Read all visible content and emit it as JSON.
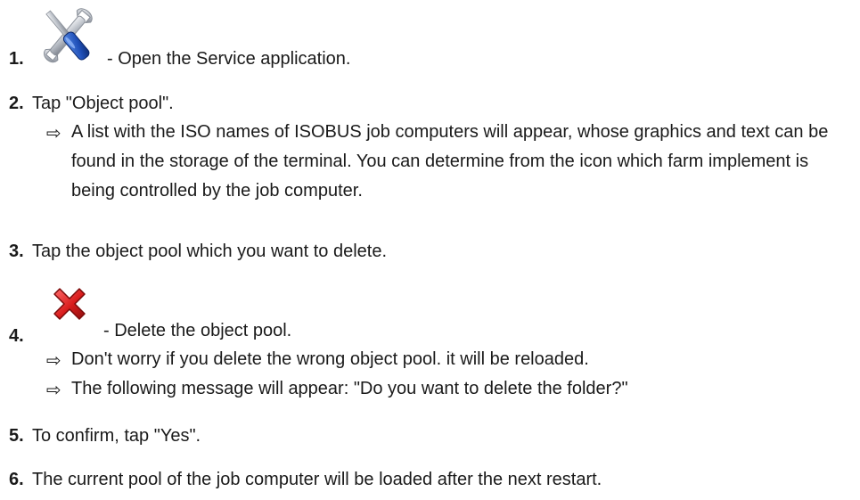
{
  "steps": [
    {
      "num": "1.",
      "text": "- Open the Service application.",
      "icon": "service-wrench-screwdriver-icon"
    },
    {
      "num": "2.",
      "text": "Tap \"Object pool\".",
      "result": "A list with the ISO names of ISOBUS job computers will appear, whose graphics and text can be found in the storage of the terminal. You can determine from the icon which farm implement is being controlled by the job computer."
    },
    {
      "num": "3.",
      "text": "Tap the object pool which you want to delete."
    },
    {
      "num": "4.",
      "text": "- Delete the object pool.",
      "icon": "delete-x-icon",
      "results": [
        "Don't worry if you delete the wrong object pool. it will be reloaded.",
        "The following message will appear: \"Do you want to delete the folder?\""
      ]
    },
    {
      "num": "5.",
      "text": "To confirm, tap \"Yes\"."
    },
    {
      "num": "6.",
      "text": "The current pool of the job computer will be loaded after the next restart."
    }
  ],
  "arrow_glyph": "⇨"
}
